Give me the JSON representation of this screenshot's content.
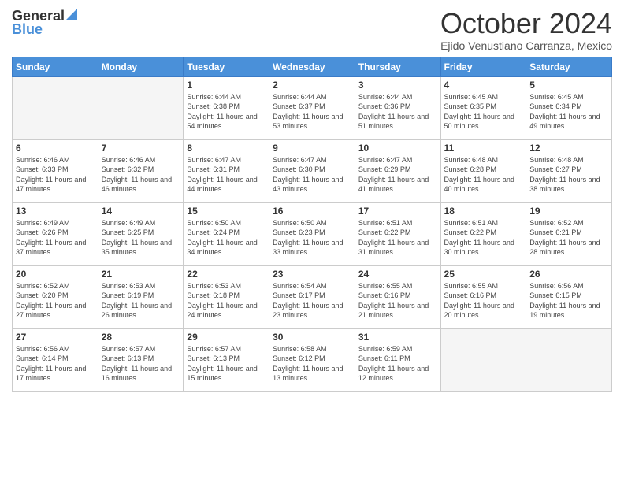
{
  "header": {
    "logo_general": "General",
    "logo_blue": "Blue",
    "month_title": "October 2024",
    "location": "Ejido Venustiano Carranza, Mexico"
  },
  "days_of_week": [
    "Sunday",
    "Monday",
    "Tuesday",
    "Wednesday",
    "Thursday",
    "Friday",
    "Saturday"
  ],
  "weeks": [
    [
      {
        "day": "",
        "empty": true
      },
      {
        "day": "",
        "empty": true
      },
      {
        "day": "1",
        "sunrise": "6:44 AM",
        "sunset": "6:38 PM",
        "daylight": "11 hours and 54 minutes."
      },
      {
        "day": "2",
        "sunrise": "6:44 AM",
        "sunset": "6:37 PM",
        "daylight": "11 hours and 53 minutes."
      },
      {
        "day": "3",
        "sunrise": "6:44 AM",
        "sunset": "6:36 PM",
        "daylight": "11 hours and 51 minutes."
      },
      {
        "day": "4",
        "sunrise": "6:45 AM",
        "sunset": "6:35 PM",
        "daylight": "11 hours and 50 minutes."
      },
      {
        "day": "5",
        "sunrise": "6:45 AM",
        "sunset": "6:34 PM",
        "daylight": "11 hours and 49 minutes."
      }
    ],
    [
      {
        "day": "6",
        "sunrise": "6:46 AM",
        "sunset": "6:33 PM",
        "daylight": "11 hours and 47 minutes."
      },
      {
        "day": "7",
        "sunrise": "6:46 AM",
        "sunset": "6:32 PM",
        "daylight": "11 hours and 46 minutes."
      },
      {
        "day": "8",
        "sunrise": "6:47 AM",
        "sunset": "6:31 PM",
        "daylight": "11 hours and 44 minutes."
      },
      {
        "day": "9",
        "sunrise": "6:47 AM",
        "sunset": "6:30 PM",
        "daylight": "11 hours and 43 minutes."
      },
      {
        "day": "10",
        "sunrise": "6:47 AM",
        "sunset": "6:29 PM",
        "daylight": "11 hours and 41 minutes."
      },
      {
        "day": "11",
        "sunrise": "6:48 AM",
        "sunset": "6:28 PM",
        "daylight": "11 hours and 40 minutes."
      },
      {
        "day": "12",
        "sunrise": "6:48 AM",
        "sunset": "6:27 PM",
        "daylight": "11 hours and 38 minutes."
      }
    ],
    [
      {
        "day": "13",
        "sunrise": "6:49 AM",
        "sunset": "6:26 PM",
        "daylight": "11 hours and 37 minutes."
      },
      {
        "day": "14",
        "sunrise": "6:49 AM",
        "sunset": "6:25 PM",
        "daylight": "11 hours and 35 minutes."
      },
      {
        "day": "15",
        "sunrise": "6:50 AM",
        "sunset": "6:24 PM",
        "daylight": "11 hours and 34 minutes."
      },
      {
        "day": "16",
        "sunrise": "6:50 AM",
        "sunset": "6:23 PM",
        "daylight": "11 hours and 33 minutes."
      },
      {
        "day": "17",
        "sunrise": "6:51 AM",
        "sunset": "6:22 PM",
        "daylight": "11 hours and 31 minutes."
      },
      {
        "day": "18",
        "sunrise": "6:51 AM",
        "sunset": "6:22 PM",
        "daylight": "11 hours and 30 minutes."
      },
      {
        "day": "19",
        "sunrise": "6:52 AM",
        "sunset": "6:21 PM",
        "daylight": "11 hours and 28 minutes."
      }
    ],
    [
      {
        "day": "20",
        "sunrise": "6:52 AM",
        "sunset": "6:20 PM",
        "daylight": "11 hours and 27 minutes."
      },
      {
        "day": "21",
        "sunrise": "6:53 AM",
        "sunset": "6:19 PM",
        "daylight": "11 hours and 26 minutes."
      },
      {
        "day": "22",
        "sunrise": "6:53 AM",
        "sunset": "6:18 PM",
        "daylight": "11 hours and 24 minutes."
      },
      {
        "day": "23",
        "sunrise": "6:54 AM",
        "sunset": "6:17 PM",
        "daylight": "11 hours and 23 minutes."
      },
      {
        "day": "24",
        "sunrise": "6:55 AM",
        "sunset": "6:16 PM",
        "daylight": "11 hours and 21 minutes."
      },
      {
        "day": "25",
        "sunrise": "6:55 AM",
        "sunset": "6:16 PM",
        "daylight": "11 hours and 20 minutes."
      },
      {
        "day": "26",
        "sunrise": "6:56 AM",
        "sunset": "6:15 PM",
        "daylight": "11 hours and 19 minutes."
      }
    ],
    [
      {
        "day": "27",
        "sunrise": "6:56 AM",
        "sunset": "6:14 PM",
        "daylight": "11 hours and 17 minutes."
      },
      {
        "day": "28",
        "sunrise": "6:57 AM",
        "sunset": "6:13 PM",
        "daylight": "11 hours and 16 minutes."
      },
      {
        "day": "29",
        "sunrise": "6:57 AM",
        "sunset": "6:13 PM",
        "daylight": "11 hours and 15 minutes."
      },
      {
        "day": "30",
        "sunrise": "6:58 AM",
        "sunset": "6:12 PM",
        "daylight": "11 hours and 13 minutes."
      },
      {
        "day": "31",
        "sunrise": "6:59 AM",
        "sunset": "6:11 PM",
        "daylight": "11 hours and 12 minutes."
      },
      {
        "day": "",
        "empty": true
      },
      {
        "day": "",
        "empty": true
      }
    ]
  ]
}
